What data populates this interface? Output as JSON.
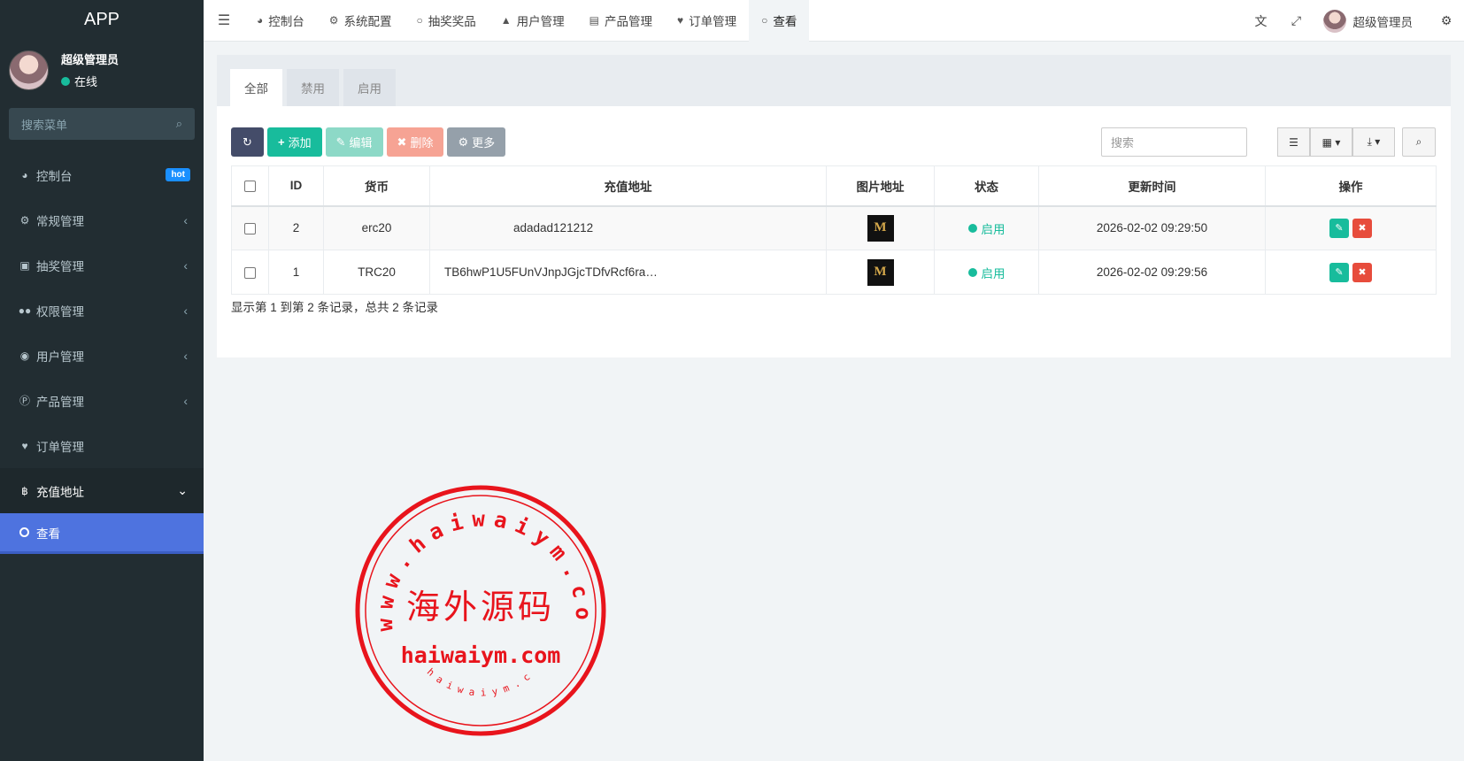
{
  "app": {
    "title": "APP"
  },
  "user": {
    "name": "超级管理员",
    "status": "在线"
  },
  "sidebar": {
    "search_placeholder": "搜索菜单",
    "items": [
      {
        "label": "控制台",
        "icon": "dashboard-icon",
        "badge": "hot"
      },
      {
        "label": "常规管理",
        "icon": "cogs-icon"
      },
      {
        "label": "抽奖管理",
        "icon": "gift-icon"
      },
      {
        "label": "权限管理",
        "icon": "group-icon"
      },
      {
        "label": "用户管理",
        "icon": "user-circle-icon"
      },
      {
        "label": "产品管理",
        "icon": "product-p-icon"
      },
      {
        "label": "订单管理",
        "icon": "heartbeat-icon"
      },
      {
        "label": "充值地址",
        "icon": "bitcoin-icon"
      }
    ],
    "sub_active": "查看"
  },
  "topnav": {
    "tabs": [
      "控制台",
      "系统配置",
      "抽奖奖品",
      "用户管理",
      "产品管理",
      "订单管理",
      "查看"
    ],
    "active": "查看",
    "user_name": "超级管理员"
  },
  "panel": {
    "tabs": [
      "全部",
      "禁用",
      "启用"
    ],
    "active_tab": "全部",
    "buttons": {
      "add": "添加",
      "edit": "编辑",
      "delete": "删除",
      "more": "更多"
    },
    "search_placeholder": "搜索"
  },
  "table": {
    "headers": [
      "ID",
      "货币",
      "充值地址",
      "图片地址",
      "状态",
      "更新时间",
      "操作"
    ],
    "rows": [
      {
        "id": "2",
        "currency": "erc20",
        "address": "adadad121212",
        "image": "M",
        "status": "启用",
        "updated": "2026-02-02 09:29:50"
      },
      {
        "id": "1",
        "currency": "TRC20",
        "address": "TB6hwP1U5FUnVJnpJGjcTDfvRcf6ra…",
        "image": "M",
        "status": "启用",
        "updated": "2026-02-02 09:29:56"
      }
    ],
    "pagination_info": "显示第 1 到第 2 条记录，总共 2 条记录"
  },
  "watermark": {
    "ring_top": "www.haiwaiym.com",
    "center": "海外源码",
    "domain": "haiwaiym.com",
    "ring_bottom": "haiwaiym.com",
    "color": "#e8141c"
  },
  "colors": {
    "sidebar": "#222d32",
    "accent": "#4e73df",
    "success": "#18bc9c",
    "danger": "#e74c3c"
  }
}
